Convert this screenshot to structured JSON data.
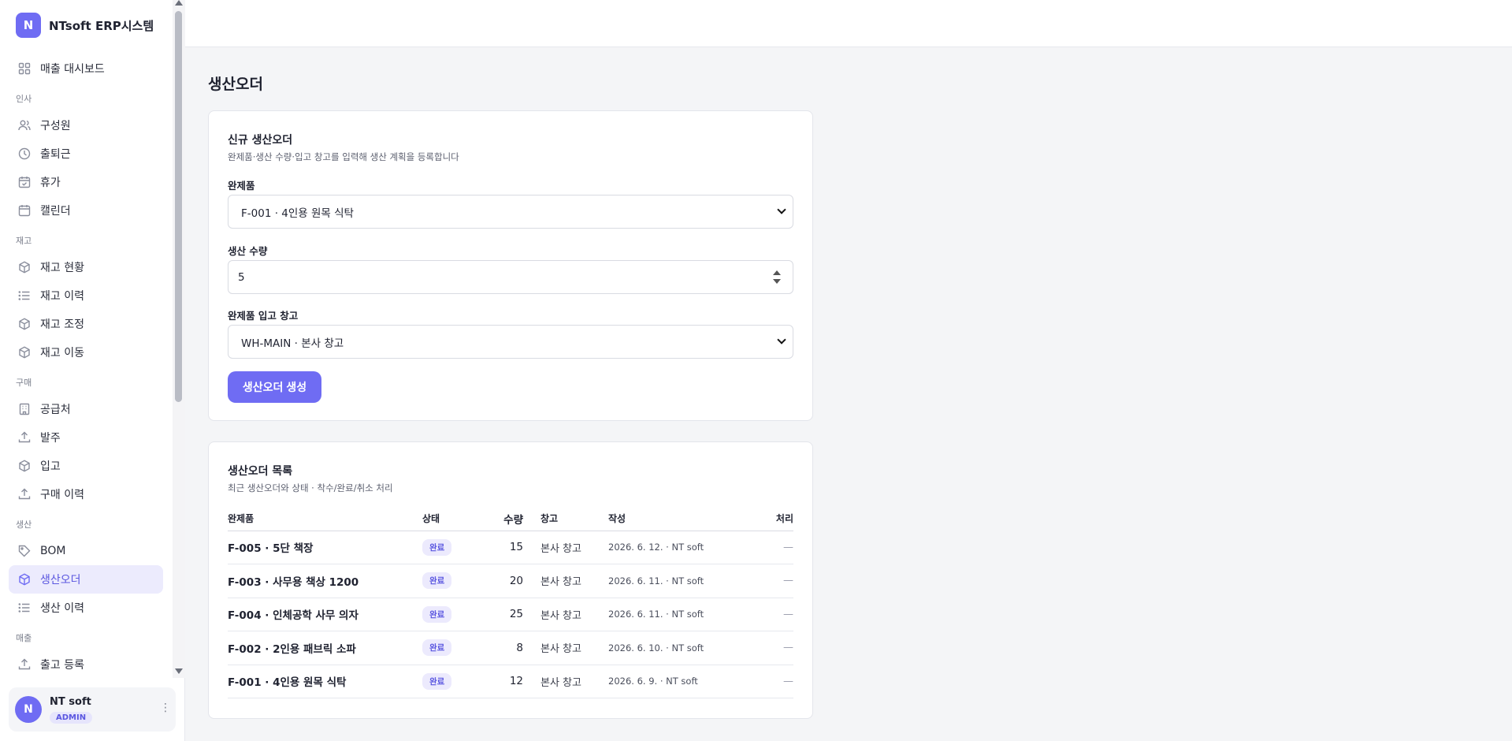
{
  "brand": {
    "logo_letter": "N",
    "name": "NTsoft ERP시스템"
  },
  "sidebar": {
    "items": [
      {
        "type": "item",
        "label": "매출 대시보드",
        "icon": "grid-icon"
      },
      {
        "type": "section",
        "label": "인사"
      },
      {
        "type": "item",
        "label": "구성원",
        "icon": "users-icon"
      },
      {
        "type": "item",
        "label": "출퇴근",
        "icon": "clock-icon"
      },
      {
        "type": "item",
        "label": "휴가",
        "icon": "calendar-check-icon"
      },
      {
        "type": "item",
        "label": "캘린더",
        "icon": "calendar-icon"
      },
      {
        "type": "section",
        "label": "재고"
      },
      {
        "type": "item",
        "label": "재고 현황",
        "icon": "box-icon"
      },
      {
        "type": "item",
        "label": "재고 이력",
        "icon": "list-icon"
      },
      {
        "type": "item",
        "label": "재고 조정",
        "icon": "box-icon"
      },
      {
        "type": "item",
        "label": "재고 이동",
        "icon": "box-icon"
      },
      {
        "type": "section",
        "label": "구매"
      },
      {
        "type": "item",
        "label": "공급처",
        "icon": "building-icon"
      },
      {
        "type": "item",
        "label": "발주",
        "icon": "upload-icon"
      },
      {
        "type": "item",
        "label": "입고",
        "icon": "box-icon"
      },
      {
        "type": "item",
        "label": "구매 이력",
        "icon": "upload-icon"
      },
      {
        "type": "section",
        "label": "생산"
      },
      {
        "type": "item",
        "label": "BOM",
        "icon": "tag-icon"
      },
      {
        "type": "item",
        "label": "생산오더",
        "icon": "box-icon",
        "active": true
      },
      {
        "type": "item",
        "label": "생산 이력",
        "icon": "list-icon"
      },
      {
        "type": "section",
        "label": "매출"
      },
      {
        "type": "item",
        "label": "출고 등록",
        "icon": "upload-icon"
      }
    ]
  },
  "user": {
    "avatar_letter": "N",
    "name": "NT soft",
    "role": "ADMIN",
    "menu_icon": "⋮"
  },
  "page": {
    "title": "생산오더"
  },
  "form": {
    "title": "신규 생산오더",
    "subtitle": "완제품·생산 수량·입고 창고를 입력해 생산 계획을 등록합니다",
    "product_label": "완제품",
    "product_value": "F-001 · 4인용 원목 식탁",
    "qty_label": "생산 수량",
    "qty_value": "5",
    "warehouse_label": "완제품 입고 창고",
    "warehouse_value": "WH-MAIN · 본사 창고",
    "submit_label": "생산오더 생성"
  },
  "list": {
    "title": "생산오더 목록",
    "subtitle": "최근 생산오더와 상태 · 착수/완료/취소 처리",
    "headers": {
      "product": "완제품",
      "status": "상태",
      "qty": "수량",
      "warehouse": "창고",
      "created": "작성",
      "action": "처리"
    },
    "rows": [
      {
        "product": "F-005 · 5단 책장",
        "status": "완료",
        "qty": "15",
        "warehouse": "본사 창고",
        "created": "2026. 6. 12. · NT soft",
        "action": "—"
      },
      {
        "product": "F-003 · 사무용 책상 1200",
        "status": "완료",
        "qty": "20",
        "warehouse": "본사 창고",
        "created": "2026. 6. 11. · NT soft",
        "action": "—"
      },
      {
        "product": "F-004 · 인체공학 사무 의자",
        "status": "완료",
        "qty": "25",
        "warehouse": "본사 창고",
        "created": "2026. 6. 11. · NT soft",
        "action": "—"
      },
      {
        "product": "F-002 · 2인용 패브릭 소파",
        "status": "완료",
        "qty": "8",
        "warehouse": "본사 창고",
        "created": "2026. 6. 10. · NT soft",
        "action": "—"
      },
      {
        "product": "F-001 · 4인용 원목 식탁",
        "status": "완료",
        "qty": "12",
        "warehouse": "본사 창고",
        "created": "2026. 6. 9. · NT soft",
        "action": "—"
      }
    ]
  },
  "colors": {
    "accent": "#6f6cf3",
    "active_bg": "#ecebfd"
  }
}
